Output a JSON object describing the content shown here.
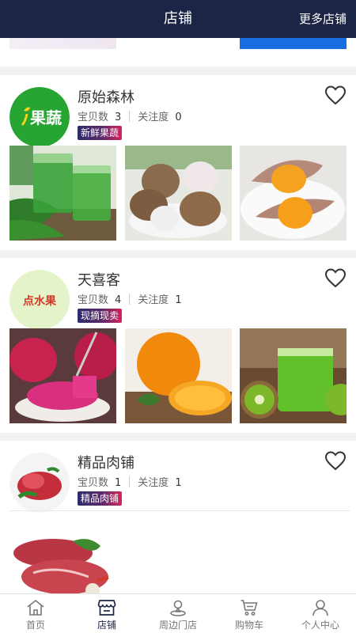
{
  "header": {
    "title": "店铺",
    "more_label": "更多店铺"
  },
  "stores": [
    {
      "name": "原始森林",
      "logo_text": "果蔬",
      "items_label": "宝贝数",
      "items_count": "3",
      "followers_label": "关注度",
      "followers_count": "0",
      "tag": "新鲜果蔬",
      "photos": [
        "spinach-juice",
        "taro",
        "roasted-sweet-potato"
      ]
    },
    {
      "name": "天喜客",
      "logo_text": "点水果",
      "items_label": "宝贝数",
      "items_count": "4",
      "followers_label": "关注度",
      "followers_count": "1",
      "tag": "现摘现卖",
      "photos": [
        "dragon-fruit",
        "orange",
        "kiwi-juice"
      ]
    },
    {
      "name": "精品肉铺",
      "items_label": "宝贝数",
      "items_count": "1",
      "followers_label": "关注度",
      "followers_count": "1",
      "tag": "精品肉铺",
      "photos": [
        "raw-beef"
      ]
    }
  ],
  "tabbar": [
    {
      "label": "首页",
      "icon": "home-icon",
      "active": false
    },
    {
      "label": "店铺",
      "icon": "store-icon",
      "active": true
    },
    {
      "label": "周边门店",
      "icon": "nearby-stores-icon",
      "active": false
    },
    {
      "label": "购物车",
      "icon": "cart-icon",
      "active": false
    },
    {
      "label": "个人中心",
      "icon": "user-icon",
      "active": false
    }
  ],
  "colors": {
    "header_bg": "#1c2546",
    "tag_gradient_start": "#2b2d6b",
    "tag_gradient_end": "#d8245c",
    "page_bg": "#f2f2f2"
  }
}
